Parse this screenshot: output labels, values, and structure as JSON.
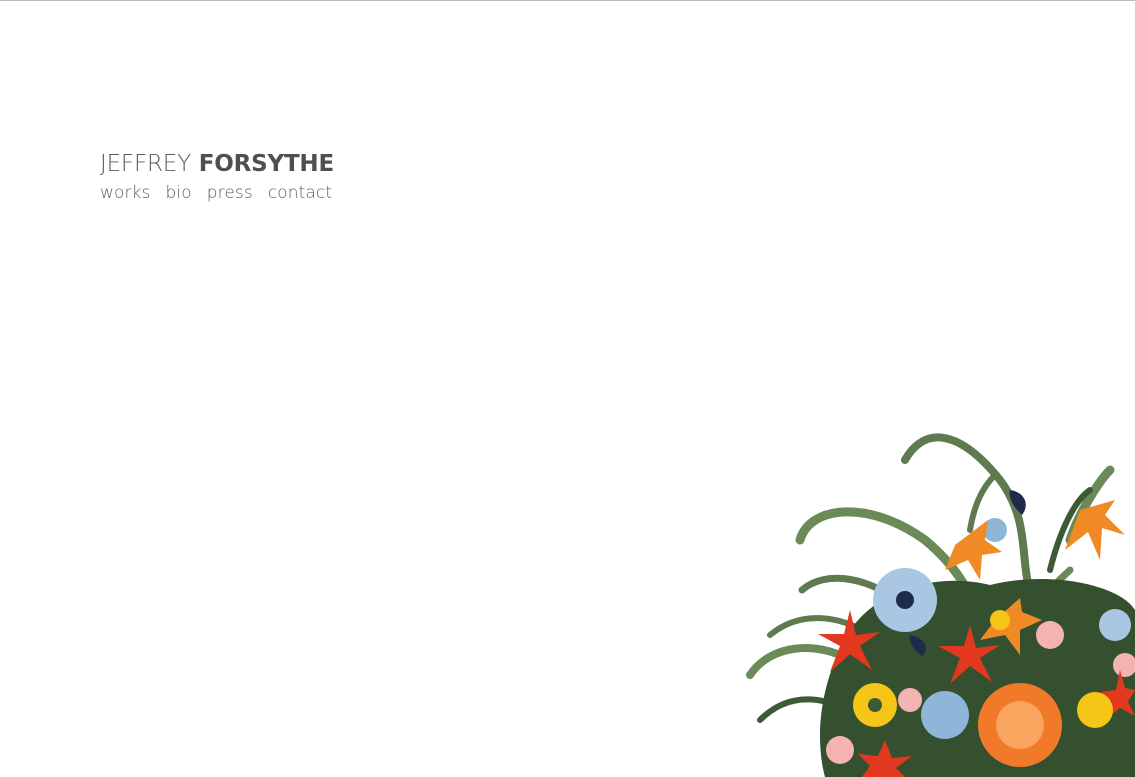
{
  "header": {
    "first_name": "JEFFREY",
    "last_name": "FORSYTHE"
  },
  "nav": {
    "items": [
      {
        "label": "works"
      },
      {
        "label": "bio"
      },
      {
        "label": "press"
      },
      {
        "label": "contact"
      }
    ]
  },
  "artwork": {
    "name": "floral-bouquet-illustration",
    "colors": {
      "leaf": "#5f7a4f",
      "leaf_dark": "#3e5a35",
      "orange": "#f08a24",
      "red": "#e2381f",
      "yellow": "#f5c518",
      "blue": "#8fb6d9",
      "pink": "#f4b3b0",
      "navy": "#1e2b4a"
    }
  }
}
